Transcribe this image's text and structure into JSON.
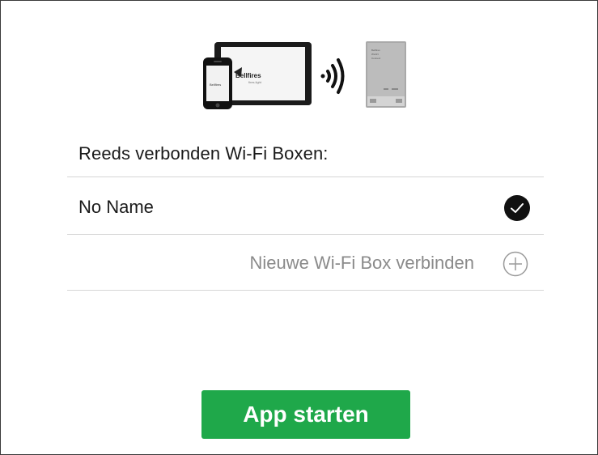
{
  "hero": {
    "logo_text": "Bellfires",
    "logo_subtext": "fires.light",
    "device_text_lines": [
      "Bellfires",
      "WLAN",
      "Connect"
    ],
    "icons": [
      "tablet-phone-icon",
      "wifi-signal-icon",
      "wifi-box-device-icon"
    ]
  },
  "connected": {
    "heading": "Reeds verbonden Wi-Fi Boxen:",
    "items": [
      {
        "name": "No Name",
        "status_icon": "check-icon"
      }
    ]
  },
  "new_box": {
    "label": "Nieuwe Wi-Fi Box verbinden",
    "icon": "plus-circle-icon"
  },
  "footer": {
    "start_label": "App starten"
  },
  "colors": {
    "accent": "#1fa84a",
    "text": "#1a1a1a",
    "muted": "#8a8a8a",
    "divider": "#d6d6d6"
  }
}
